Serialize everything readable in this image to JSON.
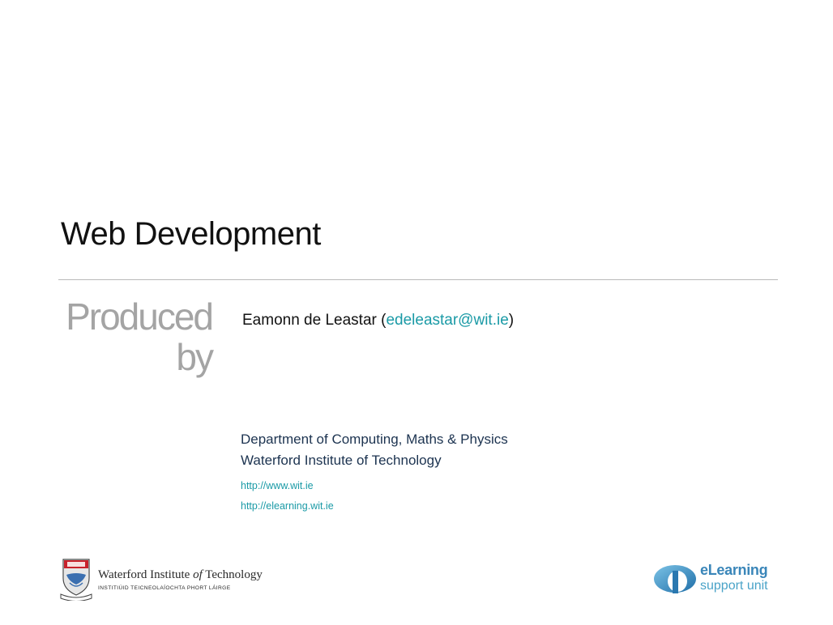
{
  "slide": {
    "title": "Web Development",
    "produced_by": {
      "line1": "Produced",
      "line2": "by"
    },
    "author": {
      "name": "Eamonn de Leastar",
      "open_paren": "(",
      "email": "edeleastar@wit.ie",
      "close_paren": ")"
    },
    "department": "Department of Computing, Maths & Physics",
    "institute": "Waterford Institute of Technology",
    "links": [
      "http://www.wit.ie",
      "http://elearning.wit.ie"
    ]
  },
  "footer": {
    "wit_logo": {
      "name_pre": "Waterford Institute ",
      "name_of": "of",
      "name_post": " Technology",
      "irish_name": "INSTITIÚID TEICNEOLAÍOCHTA PHORT LÁIRGE",
      "icon": "crest-icon"
    },
    "elearning_logo": {
      "word": "eLearning",
      "sub": "support unit",
      "icon": "elearning-mark-icon"
    }
  },
  "colors": {
    "link": "#1a9aa6",
    "department_text": "#1c3350",
    "produced_by": "#a4a4a4",
    "rule": "#b9b9b9"
  }
}
